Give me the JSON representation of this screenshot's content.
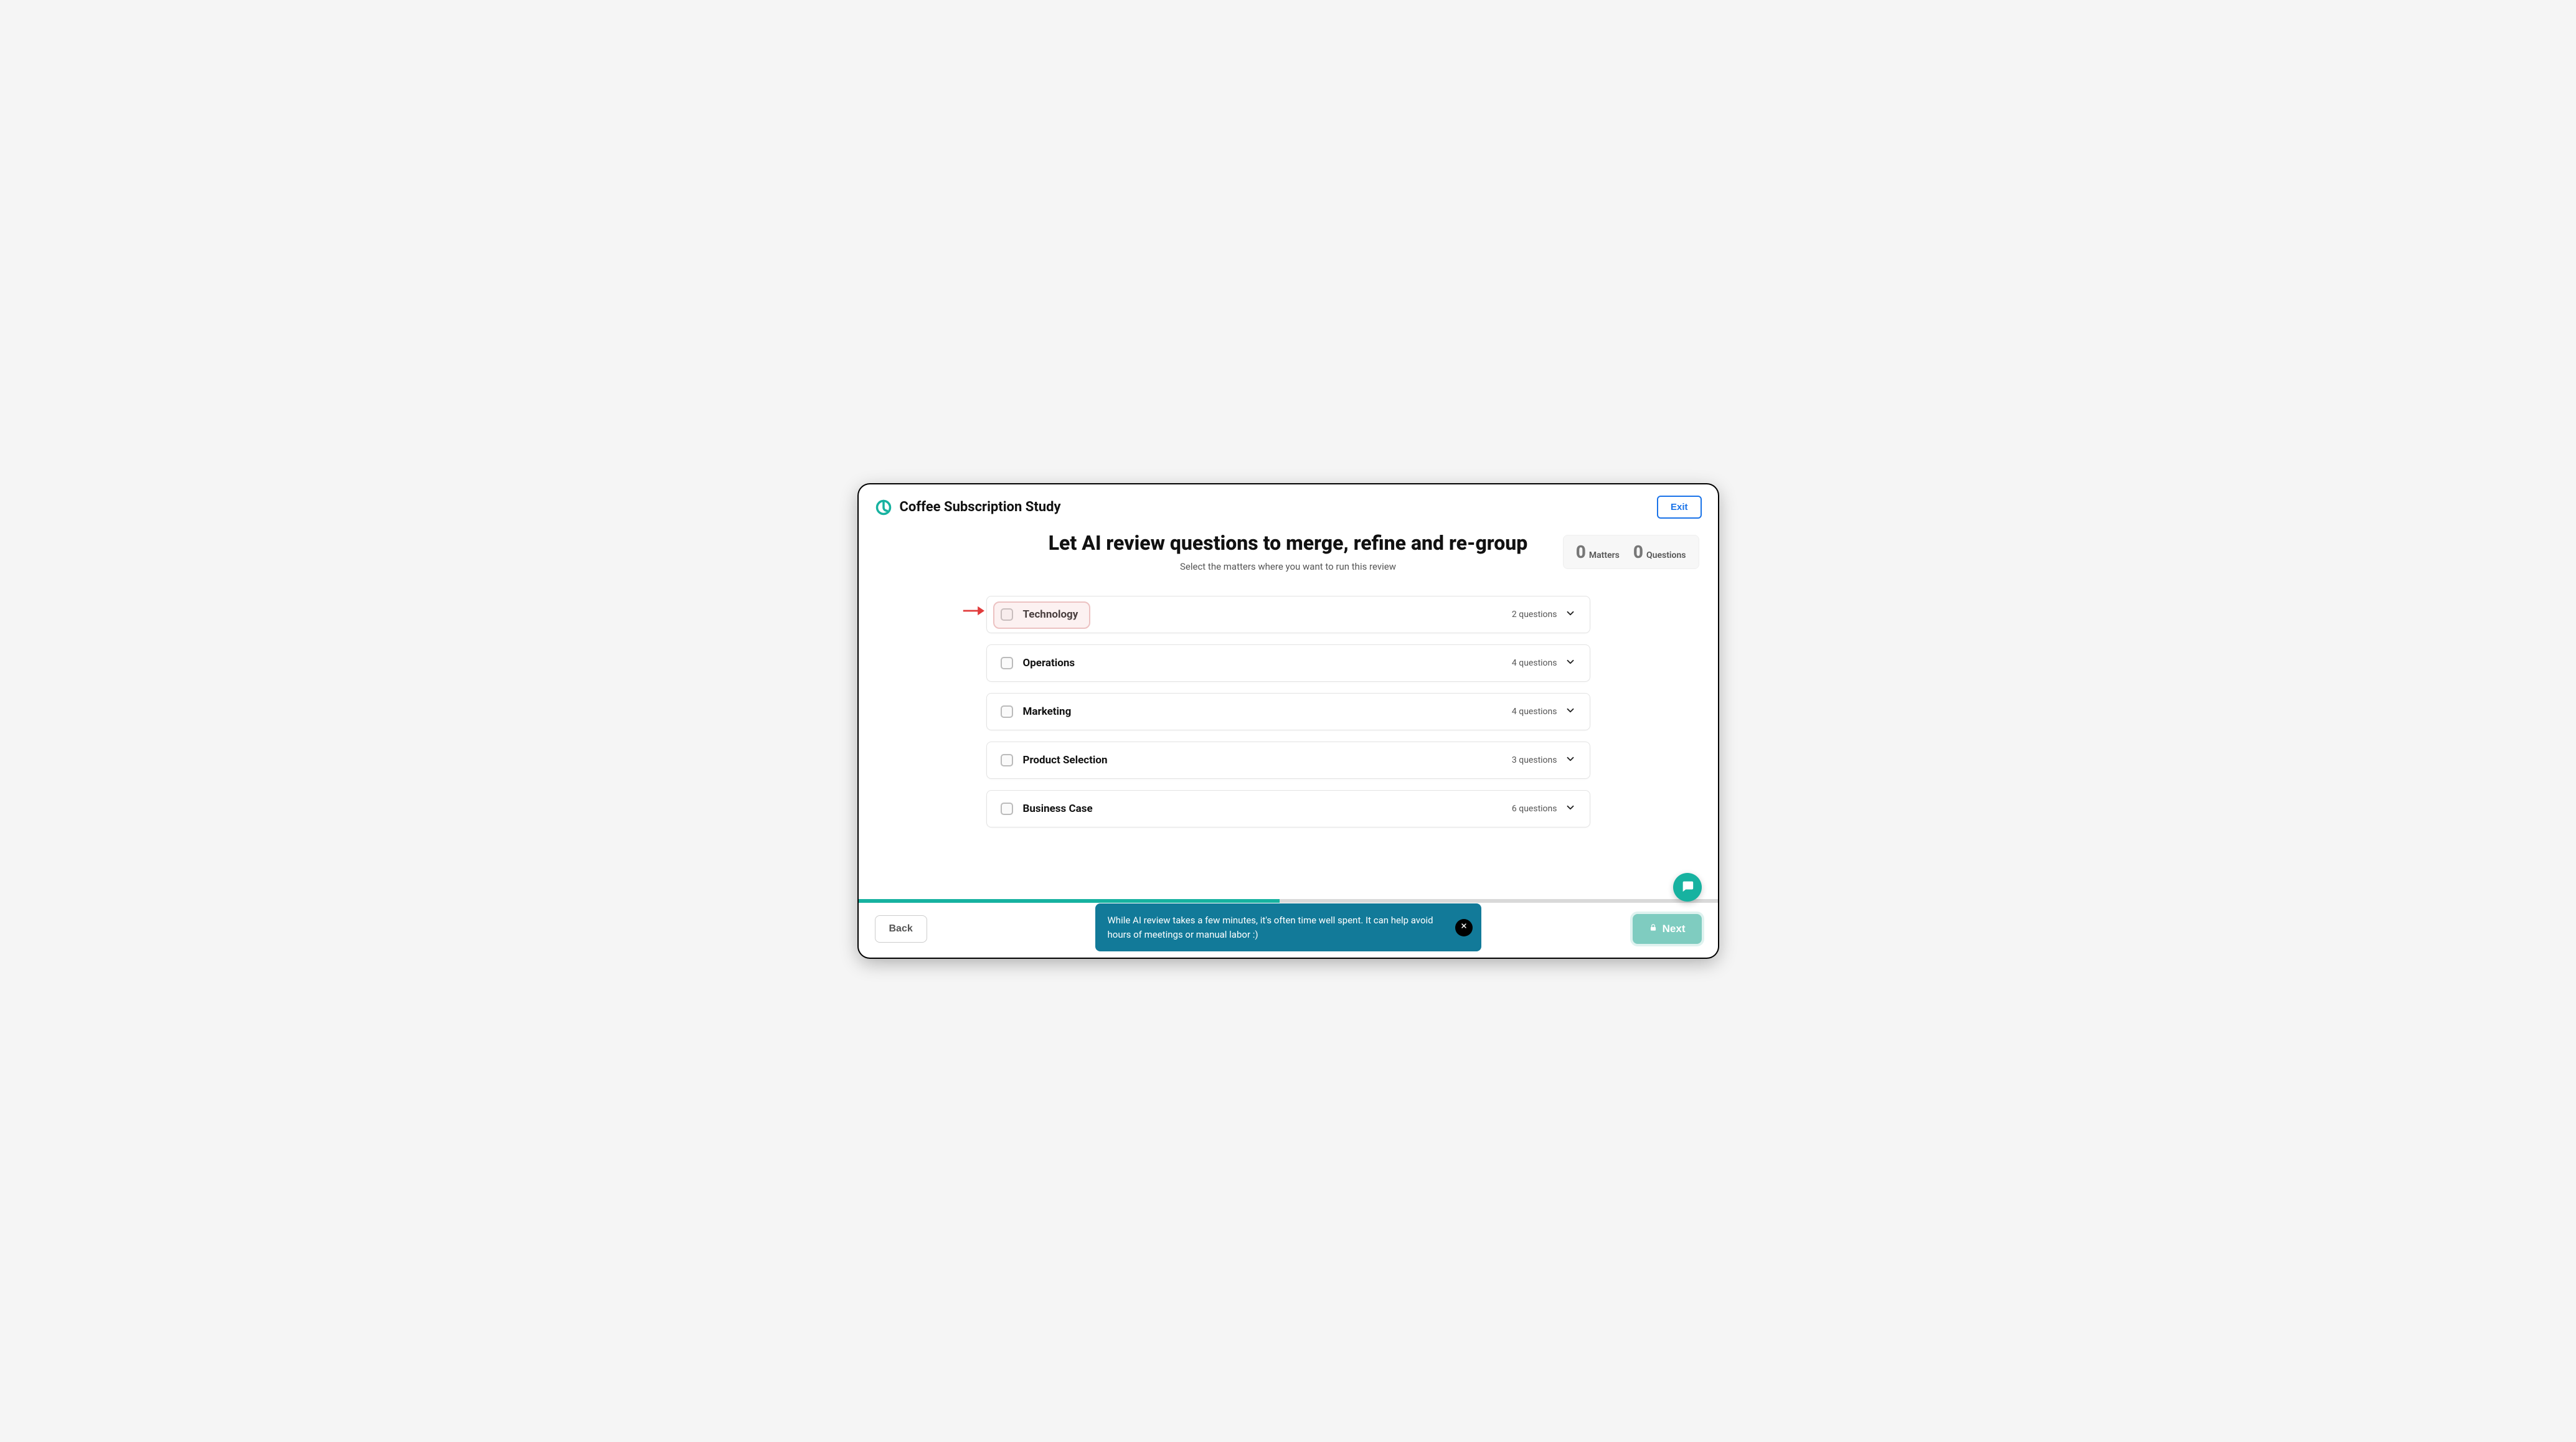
{
  "header": {
    "title": "Coffee Subscription Study",
    "exit_label": "Exit"
  },
  "hero": {
    "title": "Let AI review questions to merge, refine and re-group",
    "subtitle": "Select the matters where you want to run this review"
  },
  "stats": {
    "matters_count": "0",
    "matters_label": "Matters",
    "questions_count": "0",
    "questions_label": "Questions"
  },
  "matters": [
    {
      "name": "Technology",
      "count_text": "2 questions",
      "highlighted": true
    },
    {
      "name": "Operations",
      "count_text": "4 questions",
      "highlighted": false
    },
    {
      "name": "Marketing",
      "count_text": "4 questions",
      "highlighted": false
    },
    {
      "name": "Product Selection",
      "count_text": "3 questions",
      "highlighted": false
    },
    {
      "name": "Business Case",
      "count_text": "6 questions",
      "highlighted": false
    }
  ],
  "toast": {
    "message": "While AI review takes a few minutes, it's often time well spent. It can help avoid hours of meetings or manual labor :)"
  },
  "footer": {
    "back_label": "Back",
    "next_label": "Next"
  },
  "progress_percent": 49
}
